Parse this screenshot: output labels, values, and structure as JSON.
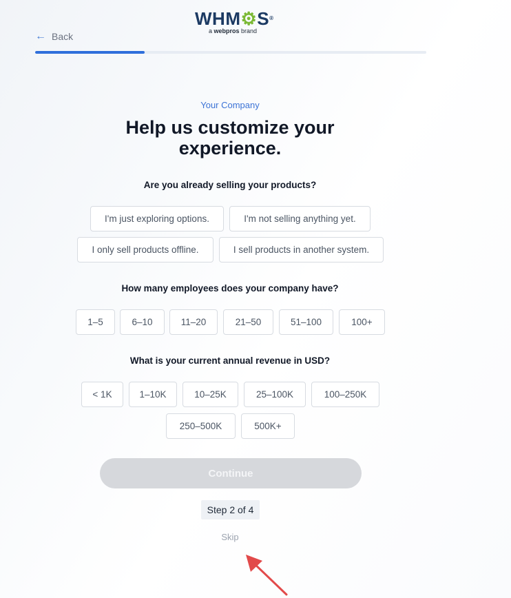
{
  "brand": {
    "logo_text_a": "WHM",
    "logo_text_b": "S",
    "logo_reg": "®",
    "sub_a": "a ",
    "sub_b": "webpros",
    "sub_c": " brand",
    "logo_gear_color": "#7bb935"
  },
  "nav": {
    "back_label": "Back",
    "back_icon": "arrow-left-icon"
  },
  "progress": {
    "value": 0.28
  },
  "header": {
    "eyebrow": "Your Company",
    "title": "Help us customize your experience."
  },
  "q1": {
    "label": "Are you already selling your products?",
    "options": [
      "I'm just exploring options.",
      "I'm not selling anything yet.",
      "I only sell products offline.",
      "I sell products in another system."
    ]
  },
  "q2": {
    "label": "How many employees does your company have?",
    "options": [
      "1–5",
      "6–10",
      "11–20",
      "21–50",
      "51–100",
      "100+"
    ]
  },
  "q3": {
    "label": "What is your current annual revenue in USD?",
    "options": [
      "< 1K",
      "1–10K",
      "10–25K",
      "25–100K",
      "100–250K",
      "250–500K",
      "500K+"
    ]
  },
  "footer": {
    "continue_label": "Continue",
    "step_label": "Step 2 of 4",
    "skip_label": "Skip"
  },
  "colors": {
    "accent": "#2f6fdb",
    "annotation": "#e24a4a"
  }
}
